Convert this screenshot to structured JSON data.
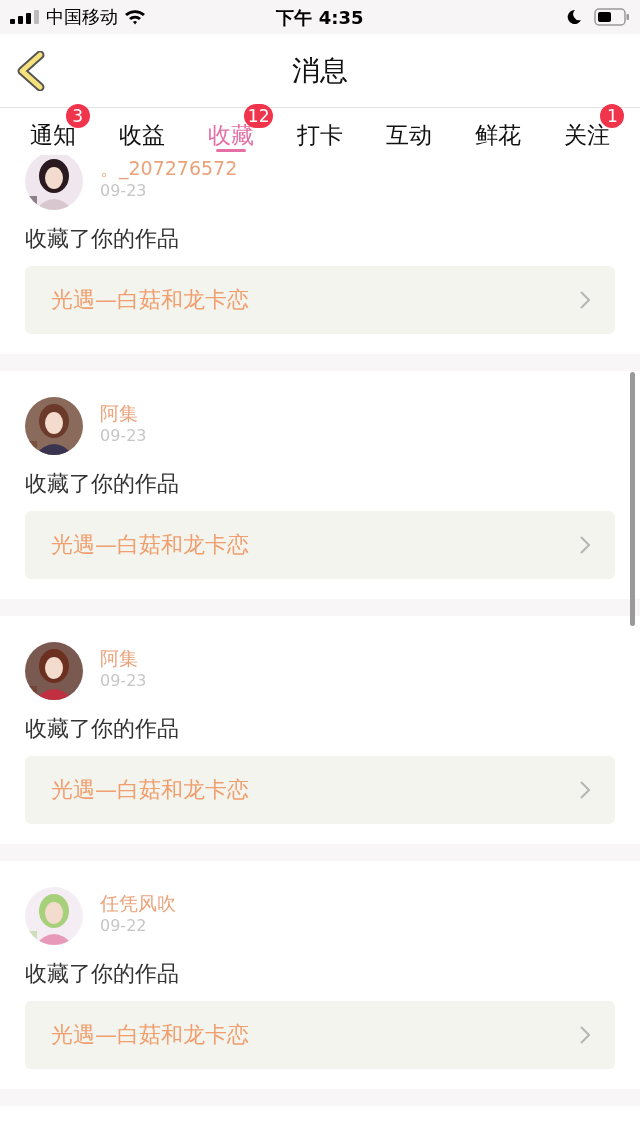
{
  "status_bar": {
    "carrier": "中国移动",
    "time": "下午 4:35"
  },
  "nav": {
    "title": "消息"
  },
  "tabs": [
    {
      "label": "通知",
      "selected": false,
      "badge": "3"
    },
    {
      "label": "收益",
      "selected": false
    },
    {
      "label": "收藏",
      "selected": true,
      "badge": "12"
    },
    {
      "label": "打卡",
      "selected": false
    },
    {
      "label": "互动",
      "selected": false
    },
    {
      "label": "鲜花",
      "selected": false
    },
    {
      "label": "关注",
      "selected": false,
      "badge": "1"
    }
  ],
  "messages": [
    {
      "user": "。_207276572",
      "date": "09-23",
      "action": "收藏了你的作品",
      "work": "光遇—白菇和龙卡恋"
    },
    {
      "user": "阿集",
      "date": "09-23",
      "action": "收藏了你的作品",
      "work": "光遇—白菇和龙卡恋"
    },
    {
      "user": "阿集",
      "date": "09-23",
      "action": "收藏了你的作品",
      "work": "光遇—白菇和龙卡恋"
    },
    {
      "user": "任凭风吹",
      "date": "09-22",
      "action": "收藏了你的作品",
      "work": "光遇—白菇和龙卡恋"
    }
  ]
}
